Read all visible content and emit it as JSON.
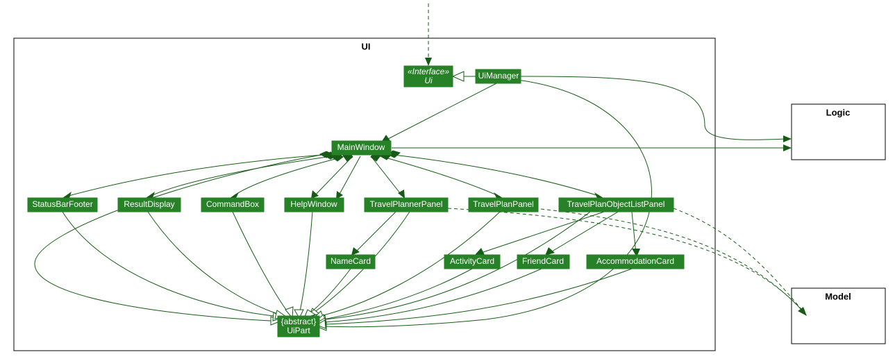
{
  "diagram_title": "UI",
  "packages": {
    "ui": {
      "label": "UI"
    },
    "logic": {
      "label": "Logic"
    },
    "model": {
      "label": "Model"
    }
  },
  "nodes": {
    "ui_interface": {
      "stereotype": "«Interface»",
      "name": "Ui"
    },
    "ui_manager": {
      "name": "UiManager"
    },
    "main_window": {
      "name": "MainWindow"
    },
    "status_bar_footer": {
      "name": "StatusBarFooter"
    },
    "result_display": {
      "name": "ResultDisplay"
    },
    "command_box": {
      "name": "CommandBox"
    },
    "help_window": {
      "name": "HelpWindow"
    },
    "travel_planner_panel": {
      "name": "TravelPlannerPanel"
    },
    "travel_plan_panel": {
      "name": "TravelPlanPanel"
    },
    "travel_plan_object_list_panel": {
      "name": "TravelPlanObjectListPanel"
    },
    "name_card": {
      "name": "NameCard"
    },
    "activity_card": {
      "name": "ActivityCard"
    },
    "friend_card": {
      "name": "FriendCard"
    },
    "accommodation_card": {
      "name": "AccommodationCard"
    },
    "ui_part": {
      "stereotype": "{abstract}",
      "name": "UiPart"
    }
  },
  "edges": [
    {
      "from": "external_top",
      "to": "ui_interface",
      "type": "dependency"
    },
    {
      "from": "ui_manager",
      "to": "ui_interface",
      "type": "realization"
    },
    {
      "from": "ui_manager",
      "to": "main_window",
      "type": "association_directed"
    },
    {
      "from": "ui_manager",
      "to": "logic",
      "type": "association_directed"
    },
    {
      "from": "main_window",
      "to": "logic",
      "type": "association_directed"
    },
    {
      "from": "main_window",
      "to": "status_bar_footer",
      "type": "composition"
    },
    {
      "from": "main_window",
      "to": "result_display",
      "type": "composition"
    },
    {
      "from": "main_window",
      "to": "command_box",
      "type": "composition"
    },
    {
      "from": "main_window",
      "to": "help_window",
      "type": "composition"
    },
    {
      "from": "main_window",
      "to": "travel_planner_panel",
      "type": "composition"
    },
    {
      "from": "main_window",
      "to": "travel_plan_panel",
      "type": "composition"
    },
    {
      "from": "main_window",
      "to": "travel_plan_object_list_panel",
      "type": "composition"
    },
    {
      "from": "travel_planner_panel",
      "to": "name_card",
      "type": "association_directed"
    },
    {
      "from": "travel_plan_object_list_panel",
      "to": "activity_card",
      "type": "association_directed"
    },
    {
      "from": "travel_plan_object_list_panel",
      "to": "friend_card",
      "type": "association_directed"
    },
    {
      "from": "travel_plan_object_list_panel",
      "to": "accommodation_card",
      "type": "association_directed"
    },
    {
      "from": "travel_plan_panel",
      "to": "model",
      "type": "dependency"
    },
    {
      "from": "travel_planner_panel",
      "to": "model",
      "type": "dependency"
    },
    {
      "from": "travel_plan_object_list_panel",
      "to": "model",
      "type": "dependency"
    },
    {
      "from": "main_window",
      "to": "ui_part",
      "type": "generalization"
    },
    {
      "from": "ui_manager",
      "to": "ui_part",
      "type": "generalization"
    },
    {
      "from": "status_bar_footer",
      "to": "ui_part",
      "type": "generalization"
    },
    {
      "from": "result_display",
      "to": "ui_part",
      "type": "generalization"
    },
    {
      "from": "command_box",
      "to": "ui_part",
      "type": "generalization"
    },
    {
      "from": "help_window",
      "to": "ui_part",
      "type": "generalization"
    },
    {
      "from": "travel_planner_panel",
      "to": "ui_part",
      "type": "generalization"
    },
    {
      "from": "travel_plan_panel",
      "to": "ui_part",
      "type": "generalization"
    },
    {
      "from": "travel_plan_object_list_panel",
      "to": "ui_part",
      "type": "generalization"
    },
    {
      "from": "name_card",
      "to": "ui_part",
      "type": "generalization"
    },
    {
      "from": "activity_card",
      "to": "ui_part",
      "type": "generalization"
    },
    {
      "from": "friend_card",
      "to": "ui_part",
      "type": "generalization"
    },
    {
      "from": "accommodation_card",
      "to": "ui_part",
      "type": "generalization"
    }
  ]
}
